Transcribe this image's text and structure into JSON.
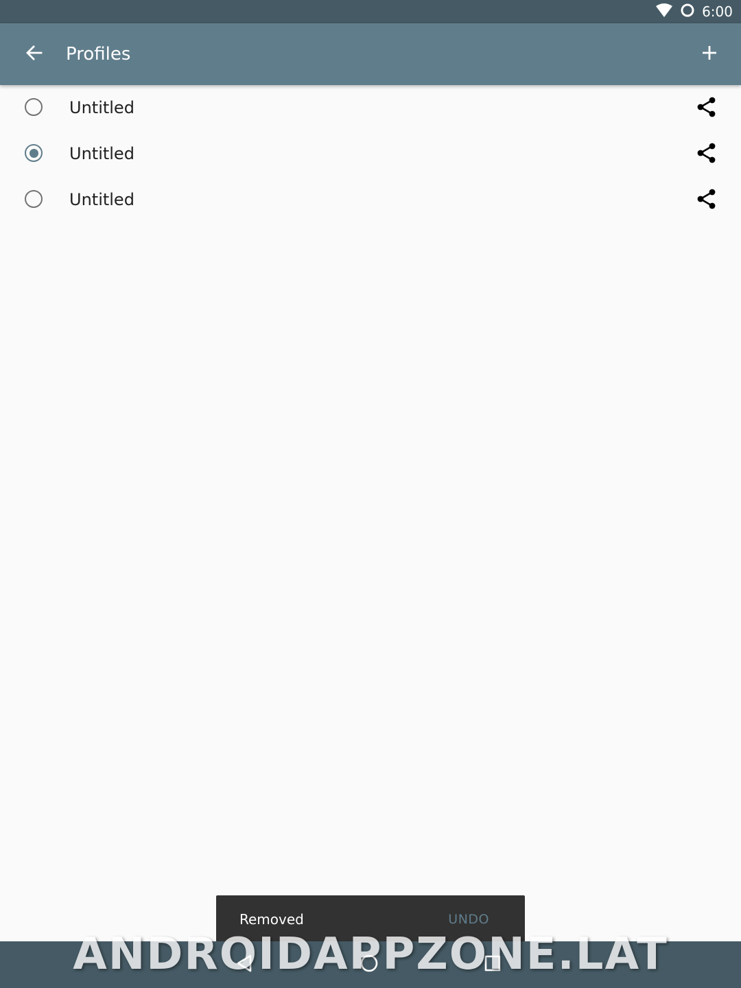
{
  "status_bar": {
    "time": "6:00",
    "icons": [
      "wifi-icon",
      "sync-circle-icon"
    ]
  },
  "app_bar": {
    "title": "Profiles",
    "back_icon": "arrow-back-icon",
    "add_icon": "plus-icon"
  },
  "profiles": [
    {
      "label": "Untitled",
      "selected": false
    },
    {
      "label": "Untitled",
      "selected": true
    },
    {
      "label": "Untitled",
      "selected": false
    }
  ],
  "snackbar": {
    "message": "Removed",
    "action": "UNDO"
  },
  "navigation": {
    "icons": [
      "back-triangle-icon",
      "home-circle-icon",
      "recents-square-icon"
    ]
  },
  "watermark": "ANDROIDAPPZONE.LAT",
  "colors": {
    "status_bar": "#455a64",
    "app_bar": "#607d8b",
    "accent": "#607d8b",
    "background": "#fafafa",
    "snackbar": "#323232"
  }
}
